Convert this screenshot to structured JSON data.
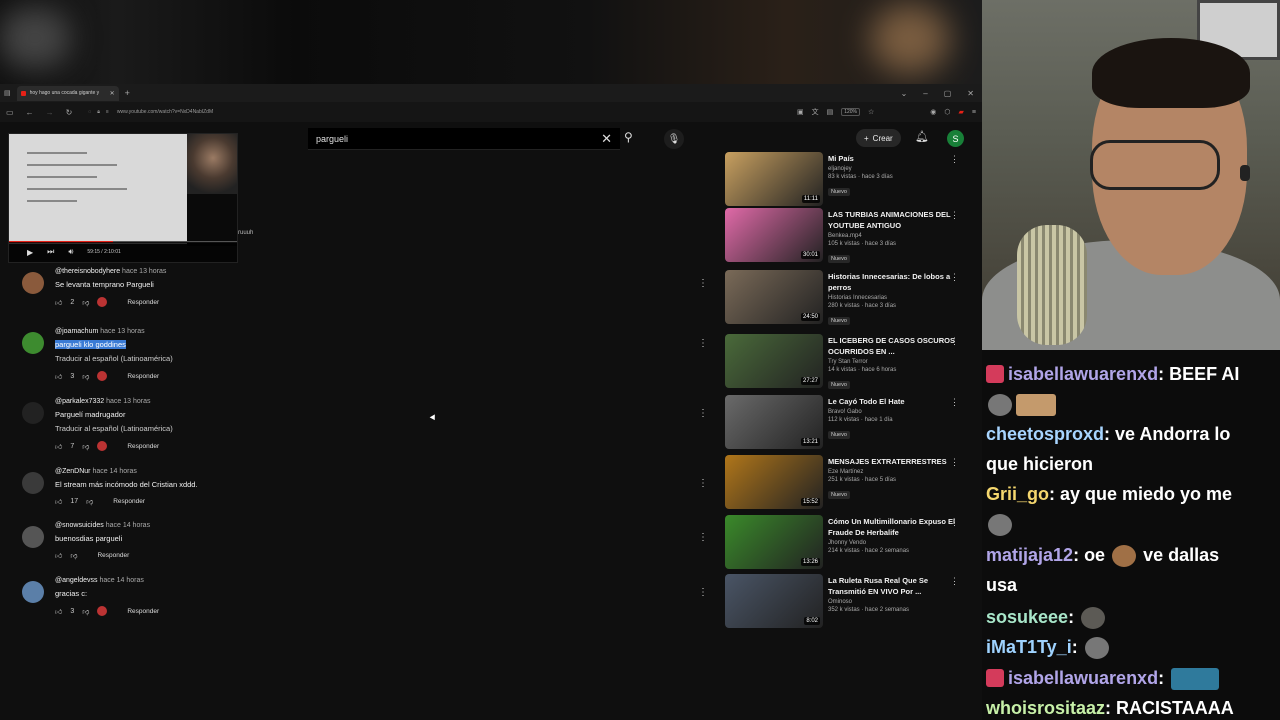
{
  "browser": {
    "tab_title": "hoy hago una cocada gigante y",
    "url": "www.youtube.com/watch?v=NxD4NabIZdM",
    "zoom": "120%"
  },
  "youtube": {
    "search_value": "pargueli",
    "create_label": "Crear",
    "avatar_letter": "S",
    "mini_player": {
      "time": "59:15 / 2:10:01",
      "side_text": "ruuuh",
      "progress": 0.45
    }
  },
  "comments": [
    {
      "author": "@thereisnobodyhere",
      "when": "hace 13 horas",
      "text": "Se levanta temprano Pargueli",
      "translate": "",
      "likes": "2",
      "reply": "Responder",
      "highlight": false,
      "avatar_color": "#8a5a3c",
      "heart": true
    },
    {
      "author": "@joamachum",
      "when": "hace 13 horas",
      "text": "pargueli klo goddines",
      "translate": "Traducir al español (Latinoamérica)",
      "likes": "3",
      "reply": "Responder",
      "highlight": true,
      "avatar_color": "#3d8b2f",
      "heart": true
    },
    {
      "author": "@parkalex7332",
      "when": "hace 13 horas",
      "text": "Parguelí madrugador",
      "translate": "Traducir al español (Latinoamérica)",
      "likes": "7",
      "reply": "Responder",
      "highlight": false,
      "avatar_color": "#222222",
      "heart": true
    },
    {
      "author": "@ZenDNur",
      "when": "hace 14 horas",
      "text": "El stream más incómodo del Cristian xddd.",
      "translate": "",
      "likes": "17",
      "reply": "Responder",
      "highlight": false,
      "avatar_color": "#3a3a3a",
      "heart": false
    },
    {
      "author": "@snowsuicides",
      "when": "hace 14 horas",
      "text": "buenosdias pargueli",
      "translate": "",
      "likes": "",
      "reply": "Responder",
      "highlight": false,
      "avatar_color": "#555555",
      "heart": false
    },
    {
      "author": "@angeldevss",
      "when": "hace 14 horas",
      "text": "gracias c:",
      "translate": "",
      "likes": "3",
      "reply": "Responder",
      "highlight": false,
      "avatar_color": "#5b7fa8",
      "heart": true
    }
  ],
  "recommendations": [
    {
      "title": "Mi País",
      "channel": "eljanojey",
      "meta": "83 k vistas · hace 3 días",
      "badge": "Nuevo",
      "duration": "11:11",
      "color": "#c8a060"
    },
    {
      "title": "LAS TURBIAS ANIMACIONES DEL YOUTUBE ANTIGUO",
      "channel": "Benkea.mp4",
      "meta": "105 k vistas · hace 3 días",
      "badge": "Nuevo",
      "duration": "30:01",
      "color": "#e06aa8"
    },
    {
      "title": "Historias Innecesarias: De lobos a perros",
      "channel": "Historias Innecesarias",
      "meta": "280 k vistas · hace 3 días",
      "badge": "Nuevo",
      "duration": "24:50",
      "color": "#7a6a58"
    },
    {
      "title": "EL ICEBERG DE CASOS OSCUROS OCURRIDOS EN ...",
      "channel": "Try Stan Terror",
      "meta": "14 k vistas · hace 6 horas",
      "badge": "Nuevo",
      "duration": "27:27",
      "color": "#4a6a3a"
    },
    {
      "title": "Le Cayó Todo El Hate",
      "channel": "Bravo! Gabo",
      "meta": "112 k vistas · hace 1 día",
      "badge": "Nuevo",
      "duration": "13:21",
      "color": "#6a6a6a"
    },
    {
      "title": "MENSAJES EXTRATERRESTRES",
      "channel": "Eze Martínez",
      "meta": "251 k vistas · hace 5 días",
      "badge": "Nuevo",
      "duration": "15:52",
      "color": "#b0761a"
    },
    {
      "title": "Cómo Un Multimillonario Expuso El Fraude De Herbalife",
      "channel": "Jhonny Vendo",
      "meta": "214 k vistas · hace 2 semanas",
      "badge": "",
      "duration": "13:26",
      "color": "#3a8a2a"
    },
    {
      "title": "La Ruleta Rusa Real Que Se Transmitió EN VIVO Por ...",
      "channel": "Ominoso",
      "meta": "352 k vistas · hace 2 semanas",
      "badge": "",
      "duration": "8:02",
      "color": "#4a5566"
    }
  ],
  "chat": [
    {
      "user": "isabellawuarenxd",
      "color": "#b1a5e8",
      "text": "BEEF AI",
      "badge": true,
      "emotes": []
    },
    {
      "user": "",
      "color": "#ffffff",
      "text": "",
      "badge": false,
      "emotes": [
        "round",
        "face"
      ]
    },
    {
      "user": "cheetosproxd",
      "color": "#a8d5ff",
      "text": "ve Andorra lo",
      "badge": false,
      "emotes": []
    },
    {
      "user": "",
      "color": "#ffffff",
      "text": "que hicieron",
      "badge": false,
      "emotes": []
    },
    {
      "user": "Grii_go",
      "color": "#f5d76e",
      "text": "ay que miedo yo me",
      "badge": false,
      "emotes": []
    },
    {
      "user": "",
      "color": "#ffffff",
      "text": "",
      "badge": false,
      "emotes": [
        "round"
      ]
    },
    {
      "user": "matijaja12",
      "color": "#b1a5e8",
      "text": "oe",
      "text2": "ve dallas",
      "badge": false,
      "emotes": [
        "face"
      ]
    },
    {
      "user": "",
      "color": "#ffffff",
      "text": "usa",
      "badge": false,
      "emotes": []
    },
    {
      "user": "sosukeee",
      "color": "#a8e6c9",
      "text": "",
      "badge": false,
      "emotes": [
        "fox"
      ]
    },
    {
      "user": "iMaT1Ty_i",
      "color": "#9fd3ff",
      "text": "",
      "badge": false,
      "emotes": [
        "round"
      ]
    },
    {
      "user": "isabellawuarenxd",
      "color": "#b1a5e8",
      "text": "",
      "badge": true,
      "emotes": [
        "wide"
      ]
    },
    {
      "user": "whoisrositaaz",
      "color": "#c7f0a8",
      "text": "RACISTAAAA",
      "badge": false,
      "emotes": []
    }
  ]
}
